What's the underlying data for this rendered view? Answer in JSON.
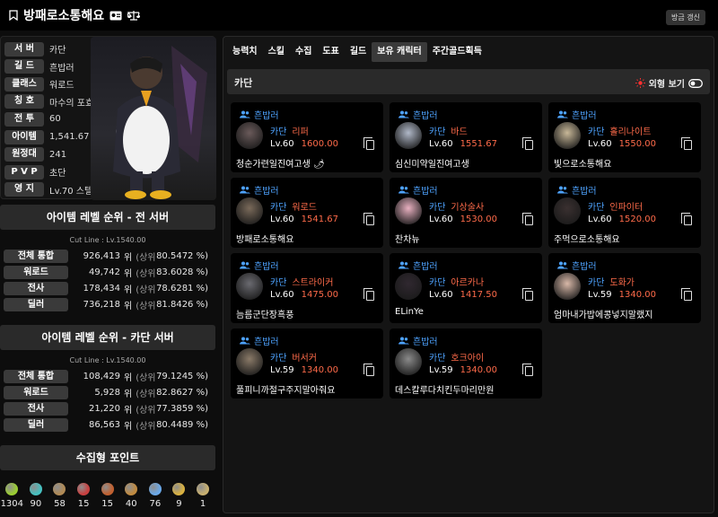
{
  "header": {
    "title": "방패로소통해요",
    "refresh_label": "방금 갱신"
  },
  "profile": {
    "rows": [
      {
        "label": "서 버",
        "value": "카단"
      },
      {
        "label": "길 드",
        "value": "흔밥러"
      },
      {
        "label": "클래스",
        "value": "워로드"
      },
      {
        "label": "칭 호",
        "value": "마수의 포효"
      },
      {
        "label": "전 투",
        "value": "60"
      },
      {
        "label": "아이템",
        "value": "1,541.67"
      },
      {
        "label": "원정대",
        "value": "241"
      },
      {
        "label": "P V P",
        "value": "초단"
      },
      {
        "label": "영 지",
        "value": "Lv.70 스텔라이브"
      }
    ]
  },
  "rank_all": {
    "title": "아이템 레벨 순위 - 전 서버",
    "cutline": "Cut Line : Lv.1540.00",
    "rows": [
      {
        "label": "전체 통합",
        "pos": "926,413",
        "wi": "위",
        "sub": "(상위",
        "pct": "80.5472 %)"
      },
      {
        "label": "워로드",
        "pos": "49,742",
        "wi": "위",
        "sub": "(상위",
        "pct": "83.6028 %)"
      },
      {
        "label": "전사",
        "pos": "178,434",
        "wi": "위",
        "sub": "(상위",
        "pct": "78.6281 %)"
      },
      {
        "label": "딜러",
        "pos": "736,218",
        "wi": "위",
        "sub": "(상위",
        "pct": "81.8426 %)"
      }
    ]
  },
  "rank_server": {
    "title": "아이템 레벨 순위 - 카단 서버",
    "cutline": "Cut Line : Lv.1540.00",
    "rows": [
      {
        "label": "전체 통합",
        "pos": "108,429",
        "wi": "위",
        "sub": "(상위",
        "pct": "79.1245 %)"
      },
      {
        "label": "워로드",
        "pos": "5,928",
        "wi": "위",
        "sub": "(상위",
        "pct": "82.8627 %)"
      },
      {
        "label": "전사",
        "pos": "21,220",
        "wi": "위",
        "sub": "(상위",
        "pct": "77.3859 %)"
      },
      {
        "label": "딜러",
        "pos": "86,563",
        "wi": "위",
        "sub": "(상위",
        "pct": "80.4489 %)"
      }
    ]
  },
  "gathering": {
    "title": "수집형 포인트",
    "items": [
      {
        "icon": "mokoko-seed-icon",
        "value": "1304",
        "color": "#9acd32"
      },
      {
        "icon": "island-heart-icon",
        "value": "90",
        "color": "#46c0c0"
      },
      {
        "icon": "great-art-icon",
        "value": "58",
        "color": "#b08a55"
      },
      {
        "icon": "giant-heart-icon",
        "value": "15",
        "color": "#c84040"
      },
      {
        "icon": "ignea-token-icon",
        "value": "15",
        "color": "#c06030"
      },
      {
        "icon": "sea-bounty-icon",
        "value": "40",
        "color": "#c08a40"
      },
      {
        "icon": "orpheus-star-icon",
        "value": "76",
        "color": "#6aa8e8"
      },
      {
        "icon": "world-tree-leaf-icon",
        "value": "9",
        "color": "#d8b040"
      },
      {
        "icon": "omnium-star-icon",
        "value": "1",
        "color": "#c8b070"
      }
    ]
  },
  "tabs": [
    {
      "label": "능력치",
      "active": false
    },
    {
      "label": "스킬",
      "active": false
    },
    {
      "label": "수집",
      "active": false
    },
    {
      "label": "도표",
      "active": false
    },
    {
      "label": "길드",
      "active": false
    },
    {
      "label": "보유 캐릭터",
      "active": true
    },
    {
      "label": "주간골드획득",
      "active": false
    }
  ],
  "server_section": {
    "name": "카단",
    "view_label": "외형 보기"
  },
  "characters": [
    {
      "guild": "흔밥러",
      "server": "카단",
      "class": "리퍼",
      "level": "Lv.60",
      "ilvl": "1600.00",
      "name": "청순가련일진여고생 🌶",
      "tone": "#6a5a5a"
    },
    {
      "guild": "흔밥러",
      "server": "카단",
      "class": "바드",
      "level": "Lv.60",
      "ilvl": "1551.67",
      "name": "심신미약일진여고생",
      "tone": "#b0b8c8"
    },
    {
      "guild": "흔밥러",
      "server": "카단",
      "class": "홀리나이트",
      "level": "Lv.60",
      "ilvl": "1550.00",
      "name": "빛으로소통해요",
      "tone": "#c8b898"
    },
    {
      "guild": "흔밥러",
      "server": "카단",
      "class": "워로드",
      "level": "Lv.60",
      "ilvl": "1541.67",
      "name": "방패로소통해요",
      "tone": "#7a6a5a"
    },
    {
      "guild": "흔밥러",
      "server": "카단",
      "class": "기상술사",
      "level": "Lv.60",
      "ilvl": "1530.00",
      "name": "찬차뉴",
      "tone": "#e8b0c0"
    },
    {
      "guild": "흔밥러",
      "server": "카단",
      "class": "인파이터",
      "level": "Lv.60",
      "ilvl": "1520.00",
      "name": "주먹으로소통해요",
      "tone": "#3a3030"
    },
    {
      "guild": "흔밥러",
      "server": "카단",
      "class": "스트라이커",
      "level": "Lv.60",
      "ilvl": "1475.00",
      "name": "늠름군단장흑풍",
      "tone": "#6a6a70"
    },
    {
      "guild": "흔밥러",
      "server": "카단",
      "class": "아르카나",
      "level": "Lv.60",
      "ilvl": "1417.50",
      "name": "ELinYe",
      "tone": "#302830"
    },
    {
      "guild": "흔밥러",
      "server": "카단",
      "class": "도화가",
      "level": "Lv.59",
      "ilvl": "1340.00",
      "name": "엄마내가밥에콩넣지말랬지",
      "tone": "#d8b8a8"
    },
    {
      "guild": "흔밥러",
      "server": "카단",
      "class": "버서커",
      "level": "Lv.59",
      "ilvl": "1340.00",
      "name": "풀피니까절구주지말아줘요",
      "tone": "#8a7a68"
    },
    {
      "guild": "흔밥러",
      "server": "카단",
      "class": "호크아이",
      "level": "Lv.59",
      "ilvl": "1340.00",
      "name": "데스칼루다치킨두마리만원",
      "tone": "#8a8a8a"
    }
  ]
}
